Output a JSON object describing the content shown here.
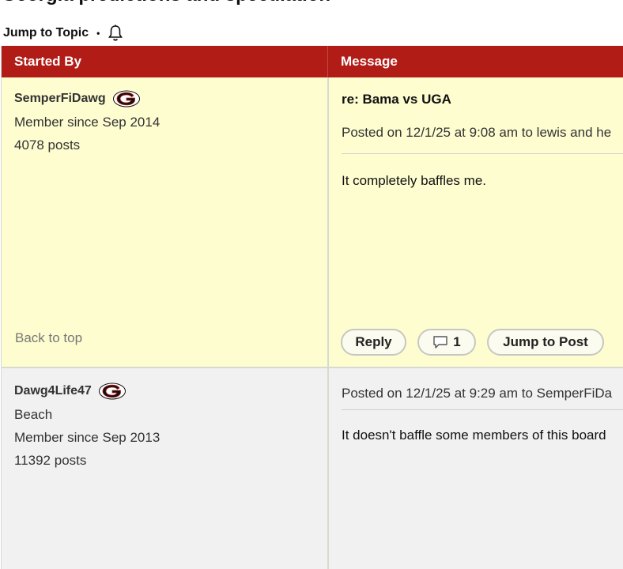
{
  "page": {
    "title": "Georgia predictions and speculation"
  },
  "topic_bar": {
    "jump_label": "Jump to Topic",
    "separator": "•",
    "bell_icon": "bell-icon"
  },
  "table_header": {
    "started_by": "Started By",
    "message": "Message",
    "header_color": "#b11c17"
  },
  "posts": [
    {
      "author": "SemperFiDawg",
      "team_icon": "georgia-g-icon",
      "location": "",
      "member_since": "Member since Sep 2014",
      "post_count": "4078 posts",
      "back_to_top": "Back to top",
      "subject": "re: Bama vs UGA",
      "posted": "Posted on 12/1/25 at 9:08 am to lewis and he",
      "body": "It completely baffles me.",
      "buttons": {
        "reply": "Reply",
        "comment_count": "1",
        "jump_to_post": "Jump to Post"
      }
    },
    {
      "author": "Dawg4Life47",
      "team_icon": "georgia-g-icon",
      "location": "Beach",
      "member_since": "Member since Sep 2013",
      "post_count": "11392 posts",
      "posted": "Posted on 12/1/25 at 9:29 am to SemperFiDa",
      "body": "It doesn't baffle some members of this board"
    }
  ]
}
